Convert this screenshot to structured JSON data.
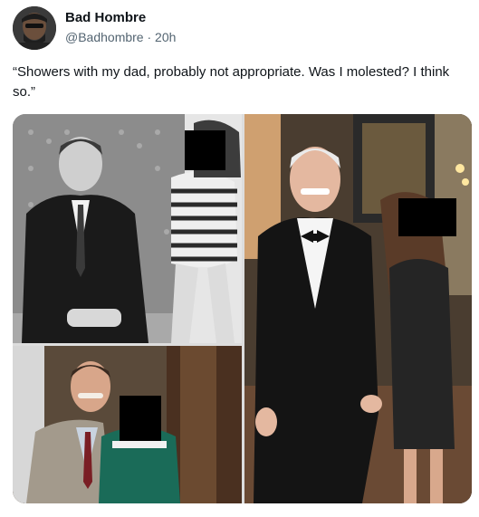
{
  "author": {
    "display_name": "Bad Hombre",
    "handle": "@Badhombre",
    "separator": "·",
    "time": "20h"
  },
  "tweet": {
    "text": "“Showers with my dad, probably not appropriate. Was I molested? I think so.”"
  },
  "media": {
    "panels": [
      {
        "name": "bw-photo-man-and-girl"
      },
      {
        "name": "photo-man-and-child-green-dress"
      },
      {
        "name": "photo-man-tuxedo-and-woman"
      }
    ]
  },
  "colors": {
    "text": "#0f1419",
    "secondary": "#536471",
    "censor": "#000000"
  }
}
